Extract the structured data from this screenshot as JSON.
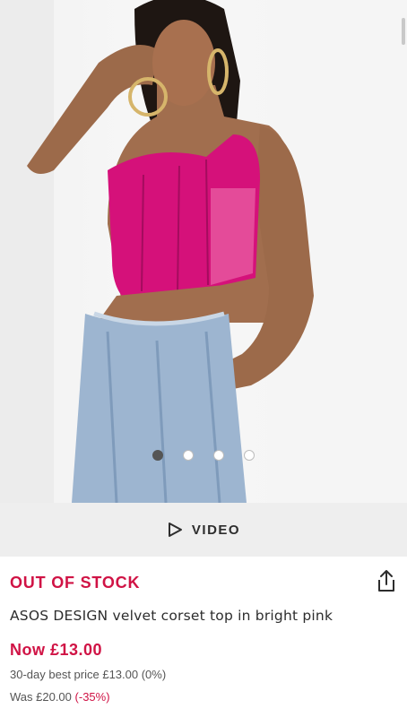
{
  "product": {
    "stock_status": "OUT OF STOCK",
    "title": "ASOS DESIGN velvet corset top in bright pink",
    "now_price": "Now £13.00",
    "best_price": "30-day best price £13.00 (0%)",
    "was_prefix": "Was £20.00",
    "was_discount": "(-35%)"
  },
  "gallery": {
    "image_count": 4,
    "active_index": 0
  },
  "video": {
    "label": "VIDEO"
  },
  "icons": {
    "play": "play-icon",
    "share": "share-icon"
  },
  "colors": {
    "accent": "#d01345",
    "text": "#2d2d2d",
    "secondary_text": "#555555",
    "video_bar": "#eeeeee"
  }
}
